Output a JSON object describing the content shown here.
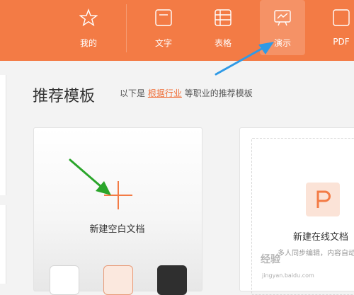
{
  "topbar": {
    "tabs": [
      {
        "label": "我的",
        "icon": "star-icon"
      },
      {
        "label": "文字",
        "icon": "document-icon"
      },
      {
        "label": "表格",
        "icon": "table-icon"
      },
      {
        "label": "演示",
        "icon": "presentation-icon",
        "active": true
      },
      {
        "label": "PDF",
        "icon": "pdf-icon"
      }
    ],
    "background": "#f37b45"
  },
  "section": {
    "title": "推荐模板",
    "subtitle_prefix": "以下是",
    "subtitle_link": "根据行业",
    "subtitle_suffix": "等职业的推荐模板"
  },
  "blank_card": {
    "label": "新建空白文档",
    "swatches": [
      "#ffffff",
      "#fbe8de",
      "#2f2f2f"
    ]
  },
  "online_card": {
    "label": "新建在线文档",
    "sub": "多人同步编辑，内容自动"
  },
  "watermark": {
    "text": "经验",
    "url": "jingyan.baidu.com"
  },
  "colors": {
    "accent": "#f37b45",
    "link": "#f0703a",
    "annotation_blue": "#2f9ae6",
    "annotation_green": "#2aa52a"
  }
}
